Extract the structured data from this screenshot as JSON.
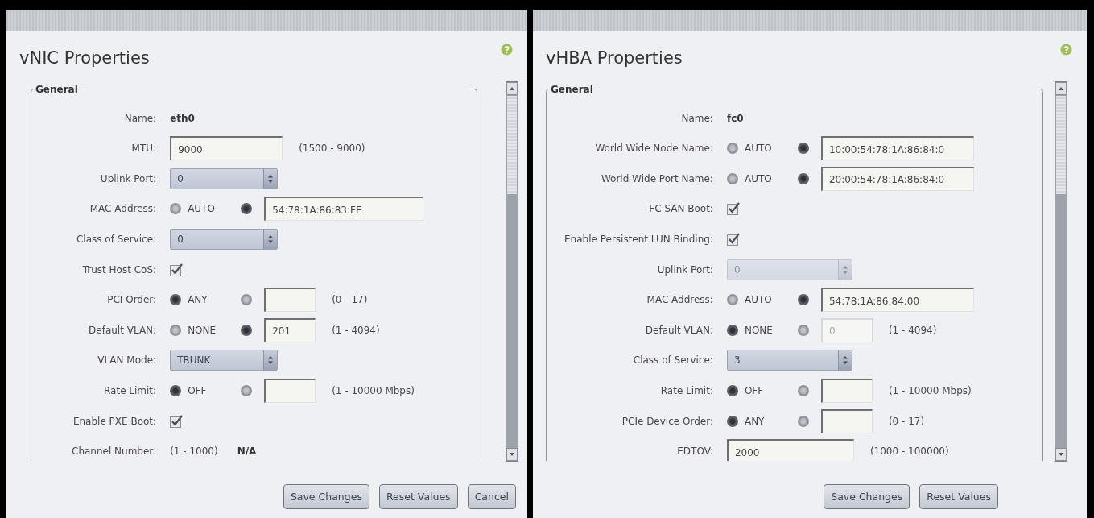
{
  "panels": [
    {
      "title": "vNIC Properties",
      "section": "General",
      "rows": [
        {
          "kind": "text",
          "label": "Name:",
          "value": "eth0"
        },
        {
          "kind": "input",
          "label": "MTU:",
          "field": {
            "value": "9000",
            "disabled": false
          },
          "range": "(1500 - 9000)"
        },
        {
          "kind": "select",
          "label": "Uplink Port:",
          "value": "0",
          "disabled": false
        },
        {
          "kind": "choice",
          "label": "MAC Address:",
          "options": [
            {
              "label": "AUTO",
              "selected": false
            },
            {
              "selected": true
            }
          ],
          "field": {
            "value": "54:78:1A:86:83:FE",
            "disabled": false
          }
        },
        {
          "kind": "select",
          "label": "Class of Service:",
          "value": "0",
          "disabled": false
        },
        {
          "kind": "checkbox",
          "label": "Trust Host CoS:",
          "checked": true
        },
        {
          "kind": "choice",
          "label": "PCI Order:",
          "options": [
            {
              "label": "ANY",
              "selected": true
            },
            {
              "selected": false
            }
          ],
          "field": {
            "disabled": false
          },
          "range": "(0 - 17)"
        },
        {
          "kind": "choice",
          "label": "Default VLAN:",
          "options": [
            {
              "label": "NONE",
              "selected": false
            },
            {
              "selected": true
            }
          ],
          "field": {
            "value": "201",
            "disabled": false
          },
          "range": "(1 - 4094)"
        },
        {
          "kind": "select",
          "label": "VLAN Mode:",
          "value": "TRUNK",
          "disabled": false
        },
        {
          "kind": "choice",
          "label": "Rate Limit:",
          "options": [
            {
              "label": "OFF",
              "selected": true
            },
            {
              "selected": false
            }
          ],
          "field": {
            "disabled": false
          },
          "range": "(1 - 10000 Mbps)"
        },
        {
          "kind": "checkbox",
          "label": "Enable PXE Boot:",
          "checked": true
        },
        {
          "kind": "range_value",
          "label": "Channel Number:",
          "range": "(1 - 1000)",
          "value": "N/A"
        }
      ],
      "buttons": [
        "Save Changes",
        "Reset Values",
        "Cancel"
      ]
    },
    {
      "title": "vHBA Properties",
      "section": "General",
      "rows": [
        {
          "kind": "text",
          "label": "Name:",
          "value": "fc0"
        },
        {
          "kind": "choice",
          "label": "World Wide Node Name:",
          "options": [
            {
              "label": "AUTO",
              "selected": false
            },
            {
              "selected": true
            }
          ],
          "field": {
            "value": "10:00:54:78:1A:86:84:0",
            "disabled": false
          }
        },
        {
          "kind": "choice",
          "label": "World Wide Port Name:",
          "options": [
            {
              "label": "AUTO",
              "selected": false
            },
            {
              "selected": true
            }
          ],
          "field": {
            "value": "20:00:54:78:1A:86:84:0",
            "disabled": false
          }
        },
        {
          "kind": "checkbox",
          "label": "FC SAN Boot:",
          "checked": true
        },
        {
          "kind": "checkbox",
          "label": "Enable Persistent LUN Binding:",
          "checked": true
        },
        {
          "kind": "select",
          "label": "Uplink Port:",
          "value": "0",
          "disabled": true
        },
        {
          "kind": "choice",
          "label": "MAC Address:",
          "options": [
            {
              "label": "AUTO",
              "selected": false
            },
            {
              "selected": true
            }
          ],
          "field": {
            "value": "54:78:1A:86:84:00",
            "disabled": false
          }
        },
        {
          "kind": "choice",
          "label": "Default VLAN:",
          "options": [
            {
              "label": "NONE",
              "selected": true
            },
            {
              "selected": false
            }
          ],
          "field": {
            "value": "0",
            "disabled": true
          },
          "range": "(1 - 4094)"
        },
        {
          "kind": "select",
          "label": "Class of Service:",
          "value": "3",
          "disabled": false
        },
        {
          "kind": "choice",
          "label": "Rate Limit:",
          "options": [
            {
              "label": "OFF",
              "selected": true
            },
            {
              "selected": false
            }
          ],
          "field": {
            "disabled": false
          },
          "range": "(1 - 10000 Mbps)"
        },
        {
          "kind": "choice",
          "label": "PCIe Device Order:",
          "options": [
            {
              "label": "ANY",
              "selected": true
            },
            {
              "selected": false
            }
          ],
          "field": {
            "disabled": false
          },
          "range": "(0 - 17)"
        },
        {
          "kind": "input",
          "label": "EDTOV:",
          "field": {
            "value": "2000",
            "disabled": false
          },
          "range": "(1000 - 100000)"
        }
      ],
      "buttons": [
        "Save Changes",
        "Reset Values"
      ]
    }
  ]
}
